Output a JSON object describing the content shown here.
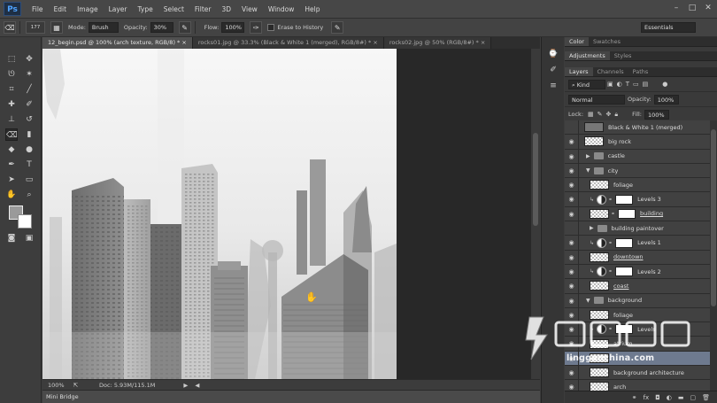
{
  "app": {
    "logo": "Ps",
    "menu": [
      "File",
      "Edit",
      "Image",
      "Layer",
      "Type",
      "Select",
      "Filter",
      "3D",
      "View",
      "Window",
      "Help"
    ],
    "window_controls": [
      "–",
      "□",
      "✕"
    ]
  },
  "options": {
    "brush_size": "177",
    "mode_label": "Mode:",
    "mode_value": "Brush",
    "opacity_label": "Opacity:",
    "opacity_value": "30%",
    "flow_label": "Flow:",
    "flow_value": "100%",
    "erase_history_label": "Erase to History",
    "workspace": "Essentials"
  },
  "doc_tabs": [
    {
      "label": "12_begin.psd @ 100% (arch texture, RGB/8) *",
      "active": true
    },
    {
      "label": "rocks01.jpg @ 33.3% (Black & White 1 (merged), RGB/8#) *",
      "active": false
    },
    {
      "label": "rocks02.jpg @ 50% (RGB/8#) *",
      "active": false
    }
  ],
  "status": {
    "zoom": "100%",
    "doc_size": "Doc: 5.93M/115.1M"
  },
  "minibridge": "Mini Bridge",
  "panels": {
    "top_tabs": [
      "Color",
      "Swatches"
    ],
    "mid_tabs": [
      "Adjustments",
      "Styles"
    ],
    "layer_tabs": [
      "Layers",
      "Channels",
      "Paths"
    ],
    "kind_label": "Kind",
    "blend_mode": "Normal",
    "opacity_label": "Opacity:",
    "opacity_value": "100%",
    "lock_label": "Lock:",
    "fill_label": "Fill:",
    "fill_value": "100%"
  },
  "layers": [
    {
      "name": "Black & White 1 (merged)",
      "type": "thumb-dark",
      "visible": false,
      "indent": 0
    },
    {
      "name": "big rock",
      "type": "thumb",
      "visible": true,
      "indent": 0
    },
    {
      "name": "castle",
      "type": "folder-closed",
      "visible": true,
      "indent": 0
    },
    {
      "name": "city",
      "type": "folder-open",
      "visible": true,
      "indent": 0
    },
    {
      "name": "foliage",
      "type": "thumb",
      "visible": true,
      "indent": 1
    },
    {
      "name": "Levels 3",
      "type": "adjustment",
      "visible": true,
      "indent": 1
    },
    {
      "name": "building",
      "type": "thumb-mask",
      "visible": true,
      "indent": 1,
      "underline": true
    },
    {
      "name": "building paintover",
      "type": "folder-closed",
      "visible": false,
      "indent": 1
    },
    {
      "name": "Levels 1",
      "type": "adjustment",
      "visible": true,
      "indent": 1
    },
    {
      "name": "downtown",
      "type": "thumb",
      "visible": true,
      "indent": 1,
      "underline": true
    },
    {
      "name": "Levels 2",
      "type": "adjustment",
      "visible": true,
      "indent": 1
    },
    {
      "name": "coast",
      "type": "thumb",
      "visible": true,
      "indent": 1,
      "underline": true
    },
    {
      "name": "background",
      "type": "folder-open",
      "visible": true,
      "indent": 0
    },
    {
      "name": "foliage",
      "type": "thumb",
      "visible": true,
      "indent": 1
    },
    {
      "name": "Levels",
      "type": "adjustment",
      "visible": true,
      "indent": 1
    },
    {
      "name": "atrium",
      "type": "thumb",
      "visible": true,
      "indent": 1
    },
    {
      "name": "",
      "type": "thumb",
      "visible": true,
      "indent": 1,
      "selected": true
    },
    {
      "name": "background architecture",
      "type": "thumb",
      "visible": true,
      "indent": 1
    },
    {
      "name": "arch",
      "type": "thumb",
      "visible": true,
      "indent": 1
    }
  ],
  "watermark": {
    "text": "lingganchina.com"
  },
  "icons": {
    "eye": "eye-icon",
    "hand_cursor": "hand-cursor-icon"
  }
}
